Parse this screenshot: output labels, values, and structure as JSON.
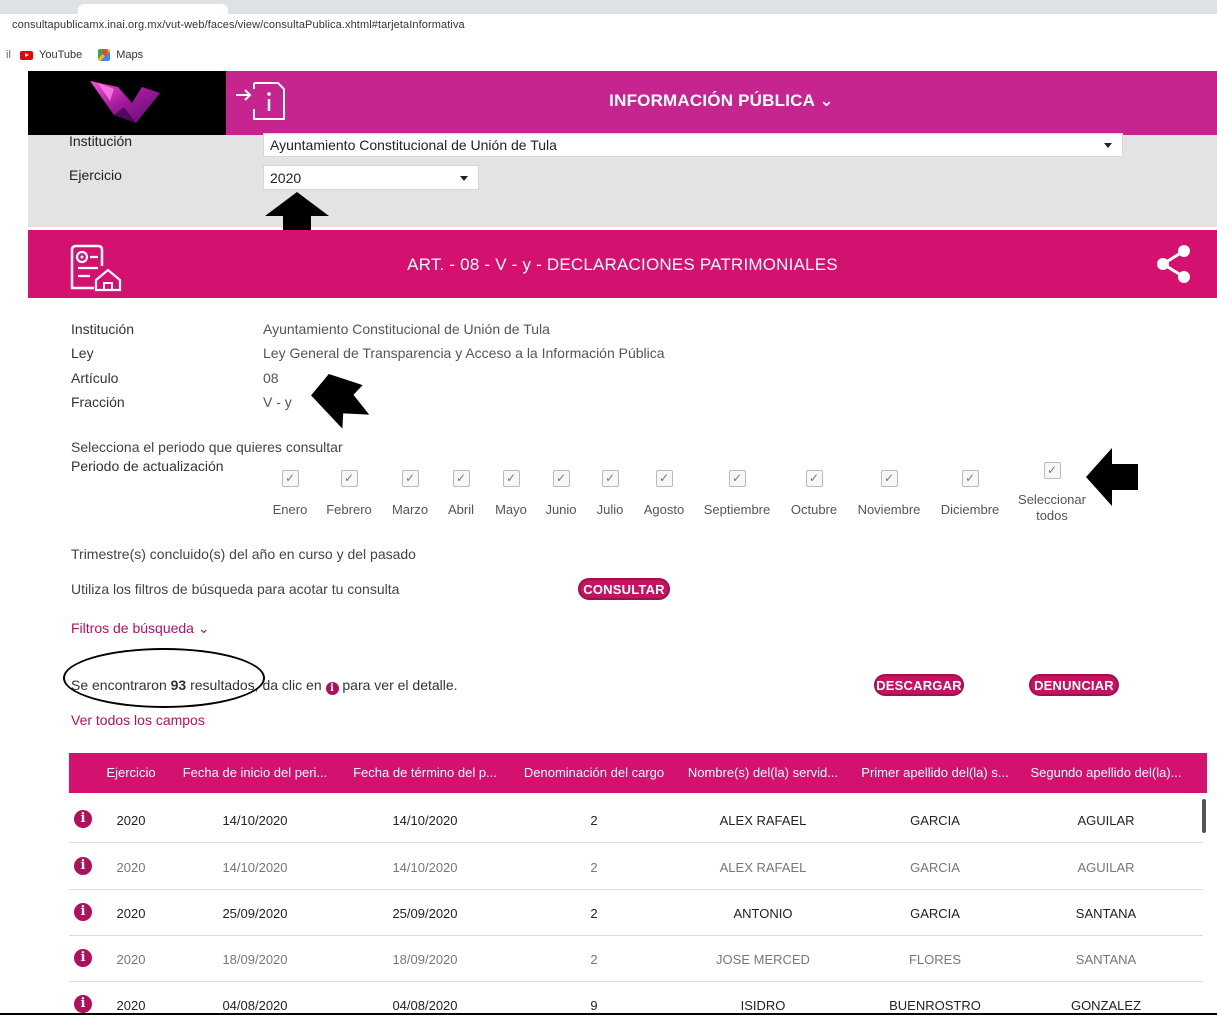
{
  "browser": {
    "url": "consultapublicamx.inai.org.mx/vut-web/faces/view/consultaPublica.xhtml#tarjetaInformativa",
    "bookmark_fragment": "il",
    "bookmarks": [
      {
        "label": "YouTube",
        "icon": "youtube-icon"
      },
      {
        "label": "Maps",
        "icon": "maps-icon"
      }
    ]
  },
  "header": {
    "title": "INFORMACIÓN PÚBLICA ⌄"
  },
  "filters": {
    "institucion_label": "Institución",
    "institucion_value": "Ayuntamiento Constitucional de Unión de Tula",
    "ejercicio_label": "Ejercicio",
    "ejercicio_value": "2020"
  },
  "section": {
    "title": "ART. - 08 - V - y - DECLARACIONES PATRIMONIALES"
  },
  "details": {
    "institucion_label": "Institución",
    "institucion_value": "Ayuntamiento Constitucional de Unión de Tula",
    "ley_label": "Ley",
    "ley_value": "Ley General de Transparencia y Acceso a la Información Pública",
    "articulo_label": "Artículo",
    "articulo_value": "08",
    "fraccion_label": "Fracción",
    "fraccion_value": "V - y"
  },
  "period": {
    "prompt": "Selecciona el periodo que quieres consultar",
    "label": "Periodo de actualización",
    "months": [
      "Enero",
      "Febrero",
      "Marzo",
      "Abril",
      "Mayo",
      "Junio",
      "Julio",
      "Agosto",
      "Septiembre",
      "Octubre",
      "Noviembre",
      "Diciembre"
    ],
    "select_all_line1": "Seleccionar",
    "select_all_line2": "todos",
    "check_glyph": "✓"
  },
  "notes": {
    "trimestre": "Trimestre(s) concluido(s) del año en curso y del pasado",
    "filtros_hint": "Utiliza los filtros de búsqueda para acotar tu consulta",
    "consultar_btn": "CONSULTAR",
    "filtros_link": "Filtros de búsqueda ⌄",
    "results_pre": "Se encontraron ",
    "results_count": "93",
    "results_mid": " resultados, da clic en ",
    "results_post": " para ver el detalle.",
    "descargar_btn": "DESCARGAR",
    "denunciar_btn": "DENUNCIAR",
    "ver_todos_link": "Ver todos los campos",
    "info_glyph": "i"
  },
  "table": {
    "headers": [
      "Ejercicio",
      "Fecha de inicio del peri...",
      "Fecha de término del p...",
      "Denominación del cargo",
      "Nombre(s) del(la) servid...",
      "Primer apellido del(la) s...",
      "Segundo apellido del(la)..."
    ],
    "rows": [
      [
        "2020",
        "14/10/2020",
        "14/10/2020",
        "2",
        "ALEX RAFAEL",
        "GARCIA",
        "AGUILAR"
      ],
      [
        "2020",
        "14/10/2020",
        "14/10/2020",
        "2",
        "ALEX RAFAEL",
        "GARCIA",
        "AGUILAR"
      ],
      [
        "2020",
        "25/09/2020",
        "25/09/2020",
        "2",
        "ANTONIO",
        "GARCIA",
        "SANTANA"
      ],
      [
        "2020",
        "18/09/2020",
        "18/09/2020",
        "2",
        "JOSE MERCED",
        "FLORES",
        "SANTANA"
      ],
      [
        "2020",
        "04/08/2020",
        "04/08/2020",
        "9",
        "ISIDRO",
        "BUENROSTRO",
        "GONZALEZ"
      ]
    ]
  },
  "colors": {
    "header_magenta": "#c6248f",
    "banner_pink": "#d4116f",
    "button_pink": "#c4145f",
    "filter_gray": "#e3e3e3"
  }
}
